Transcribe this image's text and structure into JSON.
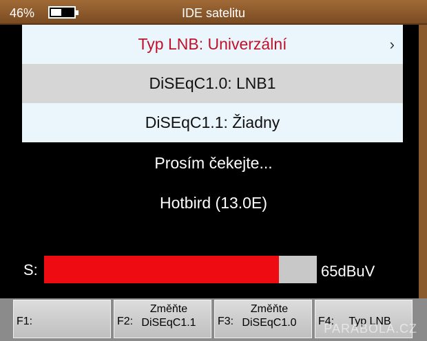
{
  "header": {
    "battery_percent": "46%",
    "battery_level": 0.46,
    "title": "IDE satelitu"
  },
  "menu": {
    "items": [
      {
        "label": "Typ LNB: Univerzální",
        "selected": true,
        "has_chevron": true,
        "chevron": "›"
      },
      {
        "label": "DiSEqC1.0: LNB1",
        "selected": false
      },
      {
        "label": "DiSEqC1.1: Žiadny",
        "selected": false
      }
    ]
  },
  "status": {
    "message": "Prosím čekejte...",
    "satellite": "Hotbird (13.0E)"
  },
  "signal": {
    "label": "S:",
    "level": 0.86,
    "value_text": "65dBuV",
    "bar_color": "#ee0b12"
  },
  "function_keys": [
    {
      "key": "F1:",
      "line1": "",
      "line2": ""
    },
    {
      "key": "F2:",
      "line1": "Změňte",
      "line2": "DiSEqC1.1"
    },
    {
      "key": "F3:",
      "line1": "Změňte",
      "line2": "DiSEqC1.0"
    },
    {
      "key": "F4:",
      "label": "Typ LNB"
    }
  ],
  "watermark": "PARABOLA.CZ",
  "colors": {
    "header": "#8a5a2c",
    "selected_text": "#c0112a",
    "menu_light": "#eaf6fb",
    "menu_gray": "#d6d6d6"
  }
}
